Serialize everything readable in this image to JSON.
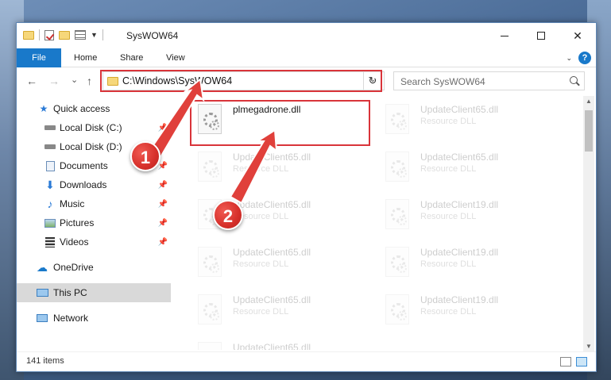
{
  "window": {
    "title": "SysWOW64",
    "controls": {
      "minimize": "minimize",
      "maximize": "maximize",
      "close": "✕"
    }
  },
  "ribbon": {
    "tabs": [
      "File",
      "Home",
      "Share",
      "View"
    ],
    "help": "?"
  },
  "nav": {
    "back": "←",
    "forward": "→",
    "recent": "⌄",
    "up": "↑",
    "address": "C:\\Windows\\SysWOW64",
    "refresh": "↻",
    "search_placeholder": "Search SysWOW64"
  },
  "sidebar": {
    "items": [
      {
        "label": "Quick access",
        "icon": "star-icon"
      },
      {
        "label": "Local Disk (C:)",
        "icon": "drive-icon"
      },
      {
        "label": "Local Disk (D:)",
        "icon": "drive-icon"
      },
      {
        "label": "Documents",
        "icon": "documents-icon"
      },
      {
        "label": "Downloads",
        "icon": "download-icon"
      },
      {
        "label": "Music",
        "icon": "music-icon"
      },
      {
        "label": "Pictures",
        "icon": "pictures-icon"
      },
      {
        "label": "Videos",
        "icon": "videos-icon"
      },
      {
        "label": "OneDrive",
        "icon": "cloud-icon"
      },
      {
        "label": "This PC",
        "icon": "computer-icon"
      },
      {
        "label": "Network",
        "icon": "network-icon"
      }
    ]
  },
  "files": [
    {
      "name": "plmegadrone.dll",
      "type": ""
    },
    {
      "name": "UpdateClient65.dll",
      "type": "Resource DLL"
    },
    {
      "name": "UpdateClient65.dll",
      "type": "Resource DLL"
    },
    {
      "name": "UpdateClient65.dll",
      "type": "Resource DLL"
    },
    {
      "name": "UpdateClient65.dll",
      "type": "Resource DLL"
    },
    {
      "name": "UpdateClient19.dll",
      "type": "Resource DLL"
    },
    {
      "name": "UpdateClient65.dll",
      "type": "Resource DLL"
    },
    {
      "name": "UpdateClient19.dll",
      "type": "Resource DLL"
    },
    {
      "name": "UpdateClient65.dll",
      "type": "Resource DLL"
    },
    {
      "name": "UpdateClient19.dll",
      "type": "Resource DLL"
    },
    {
      "name": "UpdateClient65.dll",
      "type": "Resource DLL"
    }
  ],
  "status": {
    "count": "141 items"
  },
  "annotations": {
    "step1": "1",
    "step2": "2",
    "highlight_color": "#d9343a"
  },
  "colors": {
    "accent": "#1979ca"
  }
}
